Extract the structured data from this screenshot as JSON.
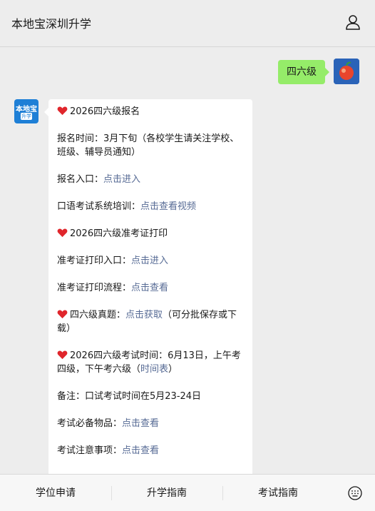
{
  "header": {
    "title": "本地宝深圳升学",
    "user_icon": "person-icon"
  },
  "user_message": {
    "text": "四六级"
  },
  "bot": {
    "avatar_line1": "本地宝",
    "avatar_line2": "升学"
  },
  "bot_message": {
    "title1": "2026四六级报名",
    "reg_time": "报名时间：3月下旬（各校学生请关注学校、班级、辅导员通知）",
    "reg_entry_label": "报名入口：",
    "reg_entry_link": "点击进入",
    "oral_label": "口语考试系统培训：",
    "oral_link": "点击查看视频",
    "title2": "2026四六级准考证打印",
    "ticket_entry_label": "准考证打印入口：",
    "ticket_entry_link": "点击进入",
    "ticket_flow_label": "准考证打印流程：",
    "ticket_flow_link": "点击查看",
    "past_label": "四六级真题：",
    "past_link": "点击获取",
    "past_note": "（可分批保存或下载）",
    "exam_time_text": "2026四六级考试时间：6月13日，上午考四级，下午考六级（",
    "exam_time_link": "时间表",
    "exam_time_end": "）",
    "note": "备注：口试考试时间在5月23-24日",
    "items_label": "考试必备物品：",
    "items_link": "点击查看",
    "notice_label": "考试注意事项：",
    "notice_link": "点击查看",
    "heart_color": "#e0262c"
  },
  "bottom_menu": {
    "tab1": "学位申请",
    "tab2": "升学指南",
    "tab3": "考试指南",
    "keyboard_icon": "keyboard-icon"
  }
}
